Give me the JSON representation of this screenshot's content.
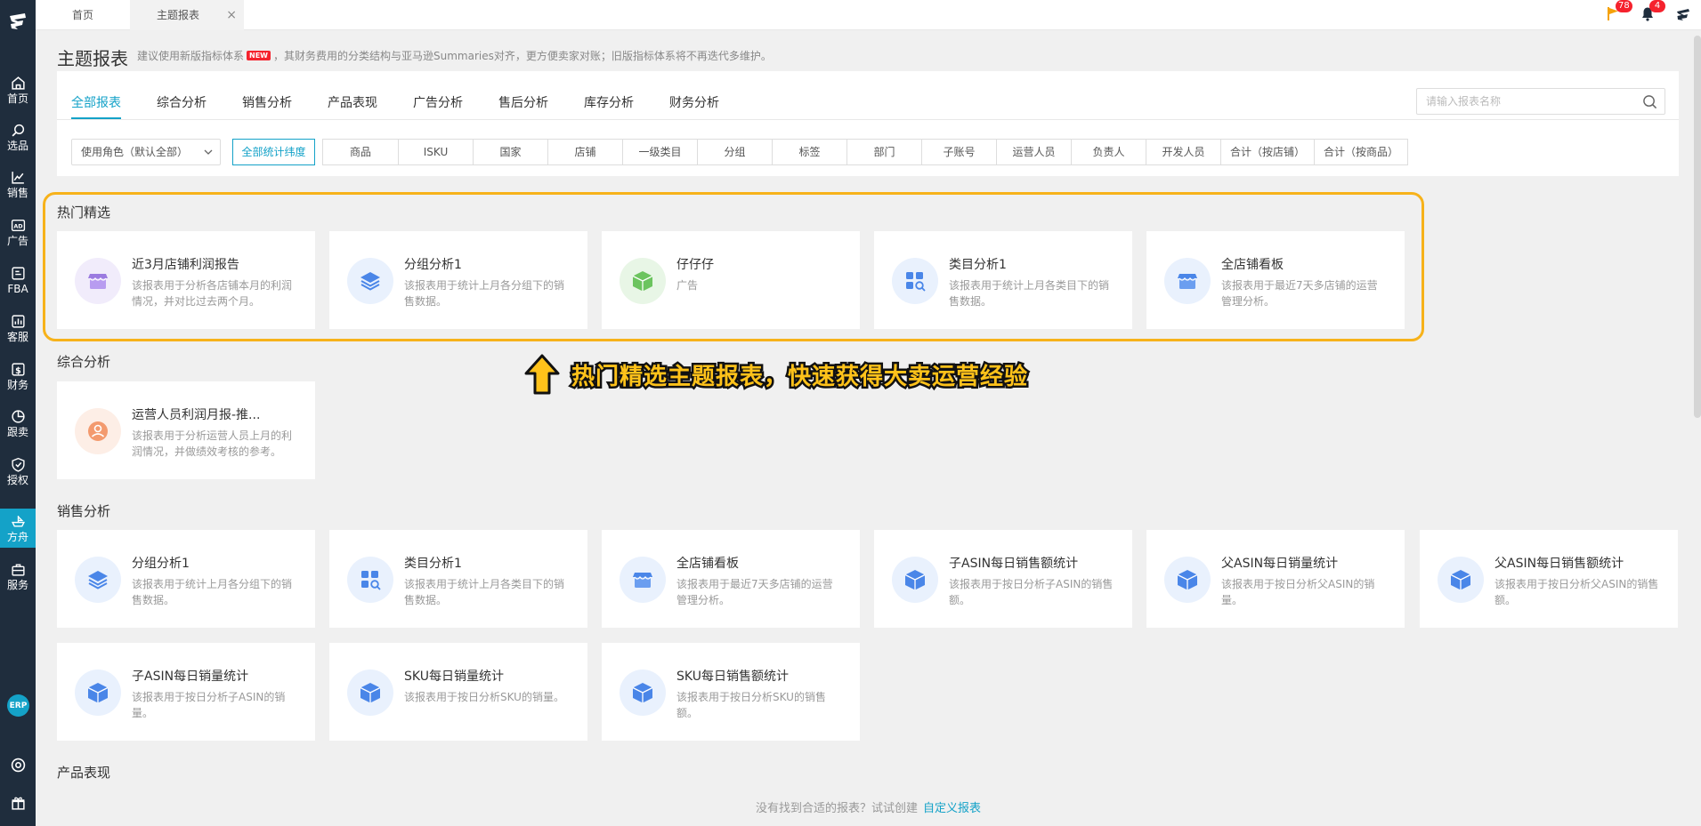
{
  "sidebar": {
    "items": [
      {
        "label": "首页",
        "icon": "home-icon"
      },
      {
        "label": "选品",
        "icon": "search-icon"
      },
      {
        "label": "销售",
        "icon": "trend-icon"
      },
      {
        "label": "广告",
        "icon": "ad-icon"
      },
      {
        "label": "FBA",
        "icon": "fba-icon"
      },
      {
        "label": "客服",
        "icon": "chart-icon"
      },
      {
        "label": "财务",
        "icon": "dollar-icon"
      },
      {
        "label": "跟卖",
        "icon": "pie-icon"
      },
      {
        "label": "授权",
        "icon": "shield-icon"
      },
      {
        "label": "方舟",
        "icon": "ark-icon"
      },
      {
        "label": "服务",
        "icon": "service-icon"
      }
    ],
    "erp_label": "ERP"
  },
  "tabs": {
    "home": "首页",
    "current": "主题报表",
    "close": "×"
  },
  "notifications": {
    "flag_count": "78",
    "bell_count": "4"
  },
  "header": {
    "title": "主题报表",
    "note_prefix": "建议使用新版指标体系",
    "new_badge": "NEW",
    "note_suffix": "，其财务费用的分类结构与亚马逊Summaries对齐，更方便卖家对账；旧版指标体系将不再迭代多维护。"
  },
  "category_tabs": [
    "全部报表",
    "综合分析",
    "销售分析",
    "产品表现",
    "广告分析",
    "售后分析",
    "库存分析",
    "财务分析"
  ],
  "search": {
    "placeholder": "请输入报表名称"
  },
  "role_select": {
    "value": "使用角色（默认全部）"
  },
  "dimensions": [
    "全部统计纬度",
    "商品",
    "ISKU",
    "国家",
    "店铺",
    "一级类目",
    "分组",
    "标签",
    "部门",
    "子账号",
    "运营人员",
    "负责人",
    "开发人员",
    "合计（按店铺）",
    "合计（按商品）"
  ],
  "sections": {
    "hot": {
      "title": "热门精选",
      "cards": [
        {
          "title": "近3月店铺利润报告",
          "desc": "该报表用于分析各店铺本月的利润情况，并对比过去两个月。",
          "icon": "store-icon"
        },
        {
          "title": "分组分析1",
          "desc": "该报表用于统计上月各分组下的销售数据。",
          "icon": "layers-icon"
        },
        {
          "title": "仔仔仔",
          "desc": "广告",
          "icon": "box-icon"
        },
        {
          "title": "类目分析1",
          "desc": "该报表用于统计上月各类目下的销售数据。",
          "icon": "category-search-icon"
        },
        {
          "title": "全店铺看板",
          "desc": "该报表用于最近7天多店铺的运营管理分析。",
          "icon": "store-icon"
        }
      ]
    },
    "comprehensive": {
      "title": "综合分析",
      "cards": [
        {
          "title": "运营人员利润月报-推...",
          "desc": "该报表用于分析运营人员上月的利润情况，并做绩效考核的参考。",
          "icon": "person-icon"
        }
      ]
    },
    "sales": {
      "title": "销售分析",
      "cards": [
        {
          "title": "分组分析1",
          "desc": "该报表用于统计上月各分组下的销售数据。",
          "icon": "layers-icon"
        },
        {
          "title": "类目分析1",
          "desc": "该报表用于统计上月各类目下的销售数据。",
          "icon": "category-search-icon"
        },
        {
          "title": "全店铺看板",
          "desc": "该报表用于最近7天多店铺的运营管理分析。",
          "icon": "store-icon"
        },
        {
          "title": "子ASIN每日销售额统计",
          "desc": "该报表用于按日分析子ASIN的销售额。",
          "icon": "box-icon"
        },
        {
          "title": "父ASIN每日销量统计",
          "desc": "该报表用于按日分析父ASIN的销量。",
          "icon": "box-icon"
        },
        {
          "title": "父ASIN每日销售额统计",
          "desc": "该报表用于按日分析父ASIN的销售额。",
          "icon": "box-icon"
        },
        {
          "title": "子ASIN每日销量统计",
          "desc": "该报表用于按日分析子ASIN的销量。",
          "icon": "box-icon"
        },
        {
          "title": "SKU每日销量统计",
          "desc": "该报表用于按日分析SKU的销量。",
          "icon": "box-icon"
        },
        {
          "title": "SKU每日销售额统计",
          "desc": "该报表用于按日分析SKU的销售额。",
          "icon": "box-icon"
        }
      ]
    },
    "product": {
      "title": "产品表现"
    }
  },
  "callout": {
    "text": "热门精选主题报表，快速获得大卖运营经验"
  },
  "footer": {
    "text": "没有找到合适的报表？试试创建",
    "link": "自定义报表"
  },
  "colors": {
    "accent": "#14a2c8",
    "sidebar": "#1f2d3d",
    "highlight": "#f7b21a",
    "badge": "#f5222d"
  }
}
